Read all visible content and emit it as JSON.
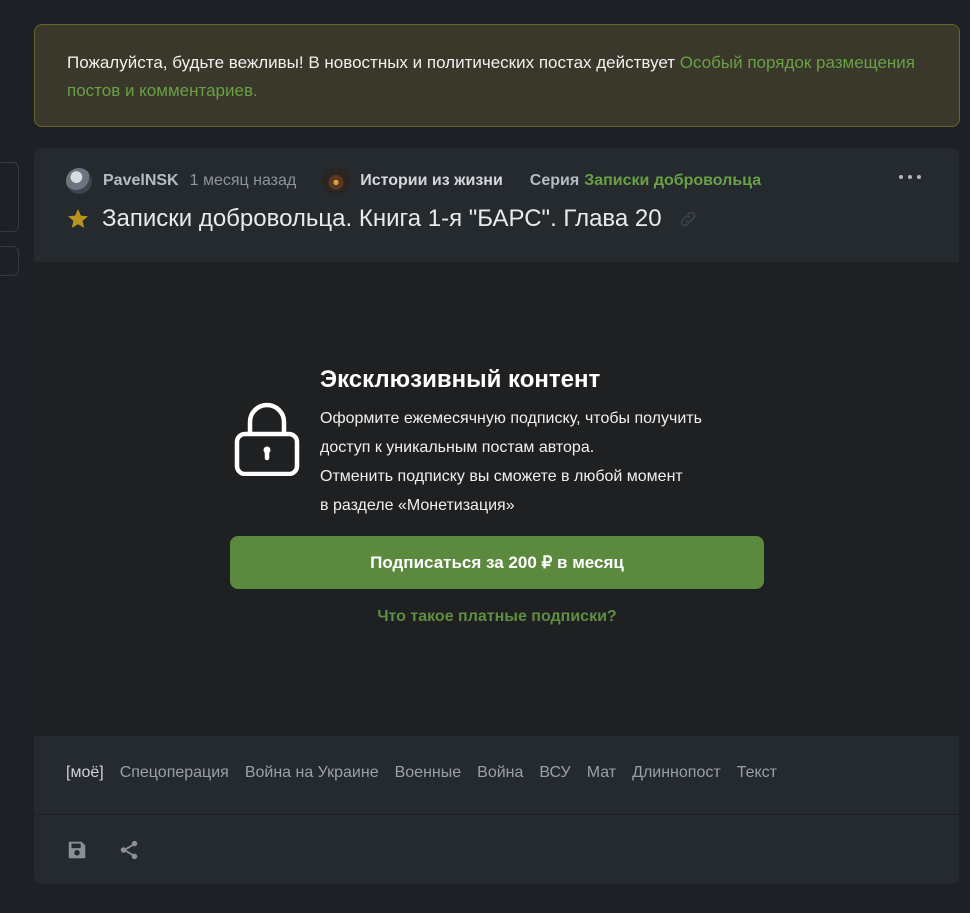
{
  "notice": {
    "text": "Пожалуйста, будьте вежливы! В новостных и политических постах действует ",
    "link": "Особый порядок размещения постов и комментариев."
  },
  "post": {
    "author": "PavelNSK",
    "time": "1 месяц назад",
    "community": "Истории из жизни",
    "series_label": "Серия",
    "series_name": "Записки добровольца",
    "title": "Записки добровольца. Книга 1-я \"БАРС\". Глава 20"
  },
  "exclusive": {
    "title": "Эксклюзивный контент",
    "line1": "Оформите ежемесячную подписку, чтобы получить",
    "line2": "доступ к уникальным постам автора.",
    "line3": "Отменить подписку вы сможете в любой момент",
    "line4": "в разделе «Монетизация»",
    "button": "Подписаться за 200 ₽ в месяц",
    "help_link": "Что такое платные подписки?"
  },
  "tags": [
    "[моё]",
    "Спецоперация",
    "Война на Украине",
    "Военные",
    "Война",
    "ВСУ",
    "Мат",
    "Длиннопост",
    "Текст"
  ],
  "icons": {
    "star": "star-icon",
    "link": "link-icon",
    "lock": "lock-icon",
    "save": "save-icon",
    "share": "share-icon",
    "more": "more-icon"
  },
  "colors": {
    "accent_green": "#6aa046",
    "button_green": "#5b8a3e",
    "star_gold": "#b8941e",
    "notice_bg": "#39382a"
  }
}
